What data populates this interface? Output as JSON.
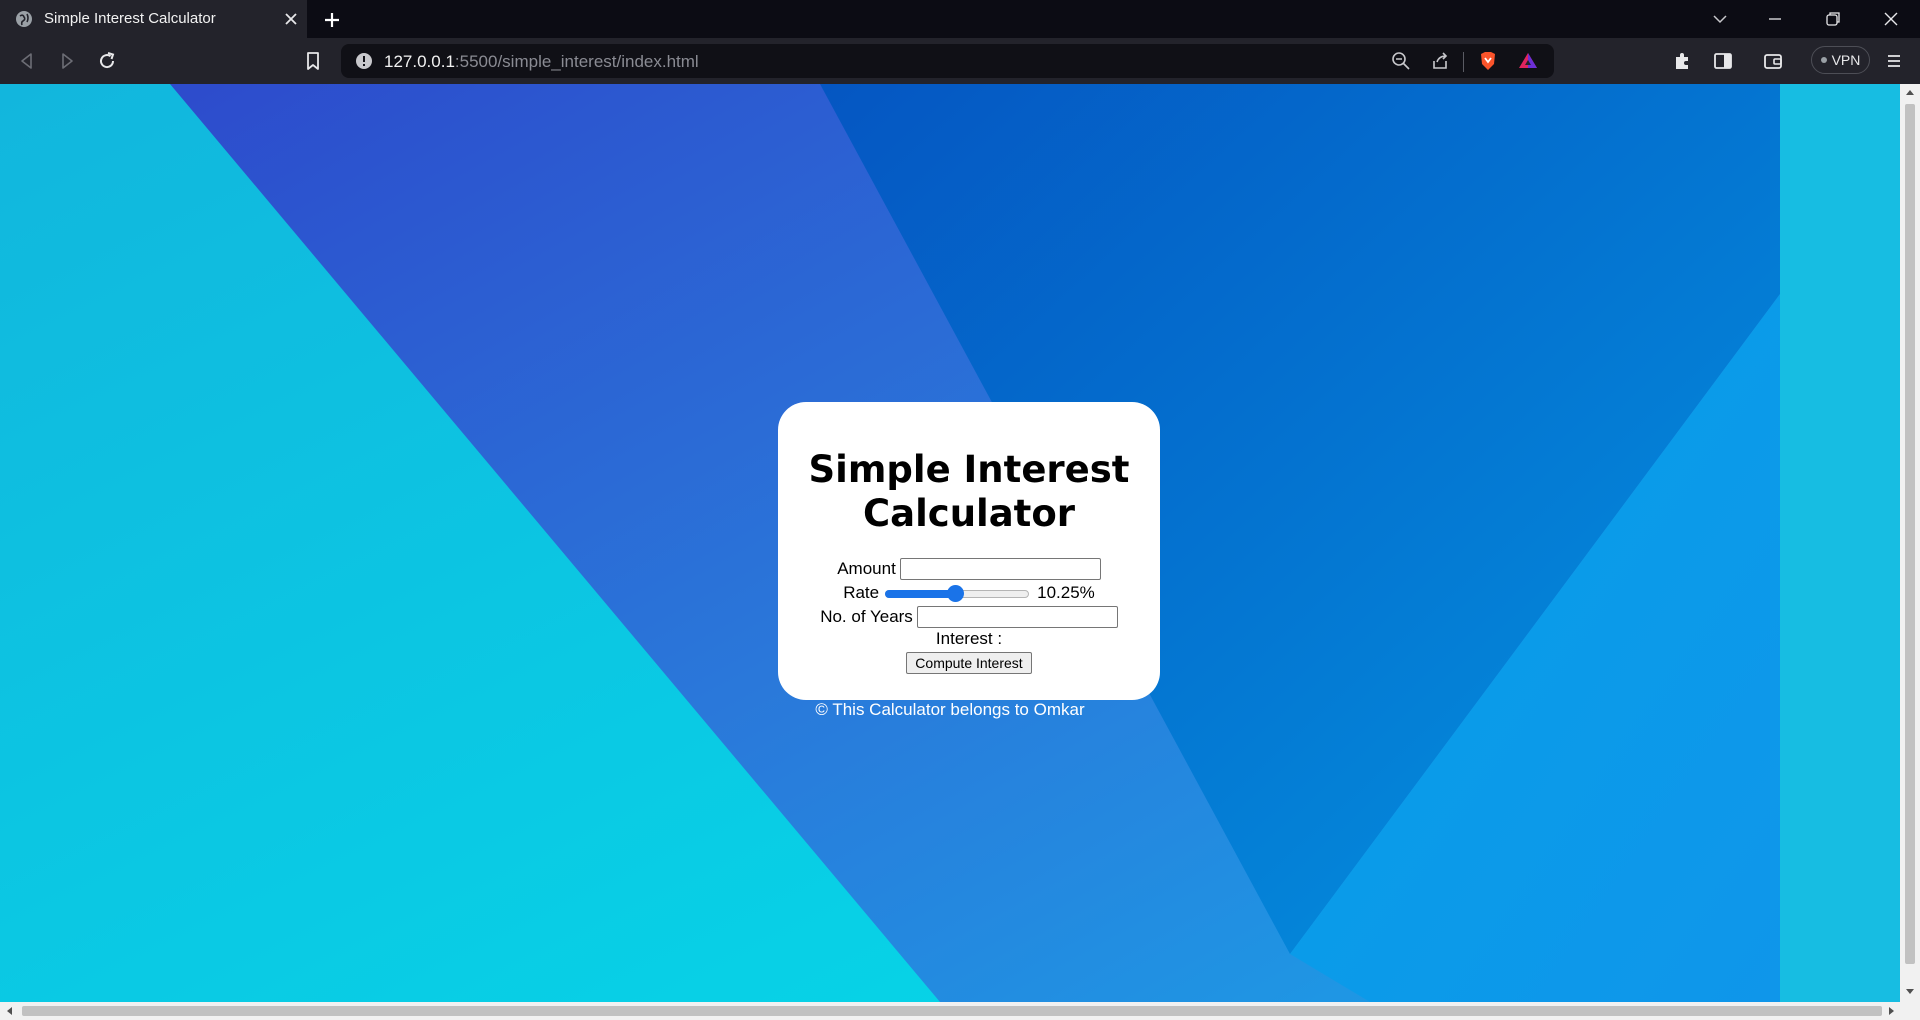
{
  "browser": {
    "tab_title": "Simple Interest Calculator",
    "url_host": "127.0.0.1",
    "url_rest": ":5500/simple_interest/index.html",
    "vpn_label": "VPN",
    "icons": [
      "globe-icon",
      "close-icon",
      "plus-icon",
      "chevron-down-icon",
      "minimize-icon",
      "restore-icon",
      "window-close-icon",
      "back-icon",
      "forward-icon",
      "reload-icon",
      "bookmark-icon",
      "info-icon",
      "zoom-out-icon",
      "share-icon",
      "brave-shield-icon",
      "brave-rewards-icon",
      "extensions-icon",
      "sidebar-icon",
      "wallet-icon",
      "menu-icon"
    ]
  },
  "calculator": {
    "title": "Simple Interest Calculator",
    "amount_label": "Amount",
    "amount_value": "",
    "rate_label": "Rate",
    "rate_value": 10.25,
    "rate_min": 1,
    "rate_max": 20,
    "rate_display": "10.25%",
    "years_label": "No. of Years",
    "years_value": "",
    "interest_label": "Interest :",
    "compute_button": "Compute Interest",
    "footer": "© This Calculator belongs to Omkar"
  },
  "colors": {
    "background_light": "#13c3e6",
    "background_dark": "#2a4fd0",
    "accent": "#1a73e8",
    "card": "#ffffff"
  }
}
